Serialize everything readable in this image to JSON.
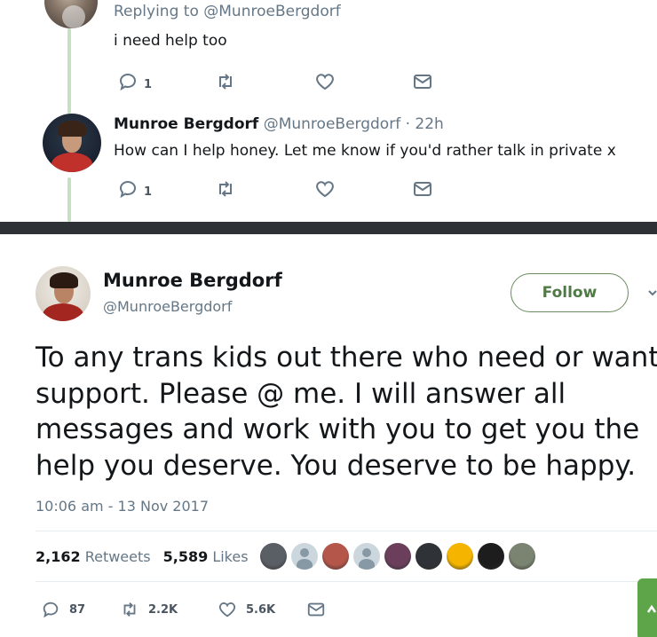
{
  "thread": {
    "reply1": {
      "replying_prefix": "Replying to",
      "replying_handle": "@MunroeBergdorf",
      "text": "i need help too",
      "reply_count": "1"
    },
    "reply2": {
      "name": "Munroe Bergdorf",
      "handle": "@MunroeBergdorf",
      "time": "· 22h",
      "text": "How can I help honey. Let me know if you'd rather talk in private x",
      "reply_count": "1"
    }
  },
  "tweet": {
    "name": "Munroe Bergdorf",
    "handle": "@MunroeBergdorf",
    "follow_label": "Follow",
    "body_lines": [
      "To any trans kids out there who need or want",
      "support. Please @ me. I will answer all",
      "messages and work with you to get you the",
      "help you deserve. You deserve to be happy."
    ],
    "timestamp": "10:06 am - 13 Nov 2017",
    "retweets_count": "2,162",
    "retweets_label": "Retweets",
    "likes_count": "5,589",
    "likes_label": "Likes",
    "reply_count": "87",
    "retweet_count_short": "2.2K",
    "like_count_short": "5.6K"
  },
  "likers": [
    {
      "kind": "photo",
      "color": "#5a5f66"
    },
    {
      "kind": "default",
      "color": "#ccd6dd"
    },
    {
      "kind": "photo",
      "color": "#b4564a"
    },
    {
      "kind": "default",
      "color": "#ccd6dd"
    },
    {
      "kind": "photo",
      "color": "#6b3f5c"
    },
    {
      "kind": "photo",
      "color": "#2f3338"
    },
    {
      "kind": "emoji",
      "color": "#f4b400"
    },
    {
      "kind": "photo",
      "color": "#1d1d1d"
    },
    {
      "kind": "photo",
      "color": "#7a8470"
    }
  ],
  "colors": {
    "text_primary": "#14171a",
    "text_secondary": "#657786",
    "follow_border": "#6a8a5f",
    "follow_text": "#4f7a45",
    "thread_line": "#c7dfc2",
    "divider": "#2e3237",
    "green_tab": "#5ea54a"
  },
  "icons": {
    "reply": "reply-icon",
    "retweet": "retweet-icon",
    "like": "heart-icon",
    "dm": "envelope-icon",
    "more": "chevron-down-icon"
  }
}
